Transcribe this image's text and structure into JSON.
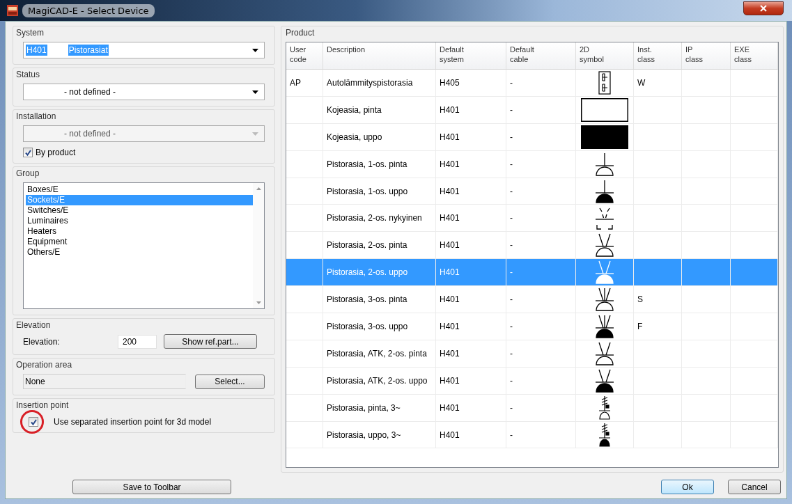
{
  "window": {
    "title": "MagiCAD-E - Select Device"
  },
  "system": {
    "label": "System",
    "code": "H401",
    "name": "Pistorasiat"
  },
  "status": {
    "label": "Status",
    "value": "- not defined -"
  },
  "installation": {
    "label": "Installation",
    "value": "- not defined -",
    "disabled": true,
    "by_product": {
      "label": "By product",
      "checked": true
    }
  },
  "group": {
    "label": "Group",
    "items": [
      {
        "label": "Boxes/E",
        "selected": false
      },
      {
        "label": "Sockets/E",
        "selected": true
      },
      {
        "label": "Switches/E",
        "selected": false
      },
      {
        "label": "Luminaires",
        "selected": false
      },
      {
        "label": "Heaters",
        "selected": false
      },
      {
        "label": "Equipment",
        "selected": false
      },
      {
        "label": "Others/E",
        "selected": false
      }
    ]
  },
  "elevation": {
    "label": "Elevation",
    "field_label": "Elevation:",
    "value": "200",
    "button": "Show ref.part..."
  },
  "operation_area": {
    "label": "Operation area",
    "value": "None",
    "button": "Select..."
  },
  "insertion_point": {
    "label": "Insertion point",
    "highlighted": true,
    "option": {
      "label": "Use separated insertion point for 3d model",
      "checked": true
    }
  },
  "save_button": "Save to Toolbar",
  "product": {
    "label": "Product",
    "columns": [
      "User\ncode",
      "Description",
      "Default\nsystem",
      "Default\ncable",
      "2D\nsymbol",
      "Inst.\nclass",
      "IP\nclass",
      "EXE\nclass"
    ],
    "rows": [
      {
        "user_code": "AP",
        "description": "Autolämmityspistorasia",
        "default_system": "H405",
        "default_cable": "-",
        "symbol": {
          "kind": "heater-box"
        },
        "inst_class": "W",
        "selected": false
      },
      {
        "description": "Kojeasia, pinta",
        "default_system": "H401",
        "default_cable": "-",
        "symbol": {
          "kind": "box",
          "filled": false
        },
        "selected": false
      },
      {
        "description": "Kojeasia, uppo",
        "default_system": "H401",
        "default_cable": "-",
        "symbol": {
          "kind": "box",
          "filled": true
        },
        "selected": false
      },
      {
        "description": "Pistorasia, 1-os. pinta",
        "default_system": "H401",
        "default_cable": "-",
        "symbol": {
          "kind": "single-socket",
          "filled": false
        },
        "selected": false
      },
      {
        "description": "Pistorasia, 1-os. uppo",
        "default_system": "H401",
        "default_cable": "-",
        "symbol": {
          "kind": "single-socket",
          "filled": true
        },
        "selected": false
      },
      {
        "description": "Pistorasia, 2-os. nykyinen",
        "default_system": "H401",
        "default_cable": "-",
        "symbol": {
          "kind": "existing-double-socket"
        },
        "selected": false
      },
      {
        "description": "Pistorasia, 2-os. pinta",
        "default_system": "H401",
        "default_cable": "-",
        "symbol": {
          "kind": "double-socket",
          "filled": false
        },
        "selected": false
      },
      {
        "description": "Pistorasia, 2-os. uppo",
        "default_system": "H401",
        "default_cable": "-",
        "symbol": {
          "kind": "double-socket",
          "filled": true
        },
        "selected": true
      },
      {
        "description": "Pistorasia, 3-os. pinta",
        "default_system": "H401",
        "default_cable": "-",
        "symbol": {
          "kind": "triple-socket",
          "filled": false
        },
        "inst_class": "S",
        "selected": false
      },
      {
        "description": "Pistorasia, 3-os. uppo",
        "default_system": "H401",
        "default_cable": "-",
        "symbol": {
          "kind": "triple-socket",
          "filled": true
        },
        "inst_class": "F",
        "selected": false
      },
      {
        "description": "Pistorasia, ATK, 2-os. pinta",
        "default_system": "H401",
        "default_cable": "-",
        "symbol": {
          "kind": "double-socket",
          "filled": false
        },
        "selected": false
      },
      {
        "description": "Pistorasia, ATK, 2-os. uppo",
        "default_system": "H401",
        "default_cable": "-",
        "symbol": {
          "kind": "double-socket",
          "filled": true
        },
        "selected": false
      },
      {
        "description": "Pistorasia, pinta, 3~",
        "default_system": "H401",
        "default_cable": "-",
        "symbol": {
          "kind": "three-phase-socket",
          "filled": false
        },
        "selected": false
      },
      {
        "description": "Pistorasia, uppo, 3~",
        "default_system": "H401",
        "default_cable": "-",
        "symbol": {
          "kind": "three-phase-socket",
          "filled": true
        },
        "selected": false
      }
    ]
  },
  "buttons": [
    {
      "label": "Ok",
      "default": true
    },
    {
      "label": "Cancel",
      "default": false
    }
  ]
}
